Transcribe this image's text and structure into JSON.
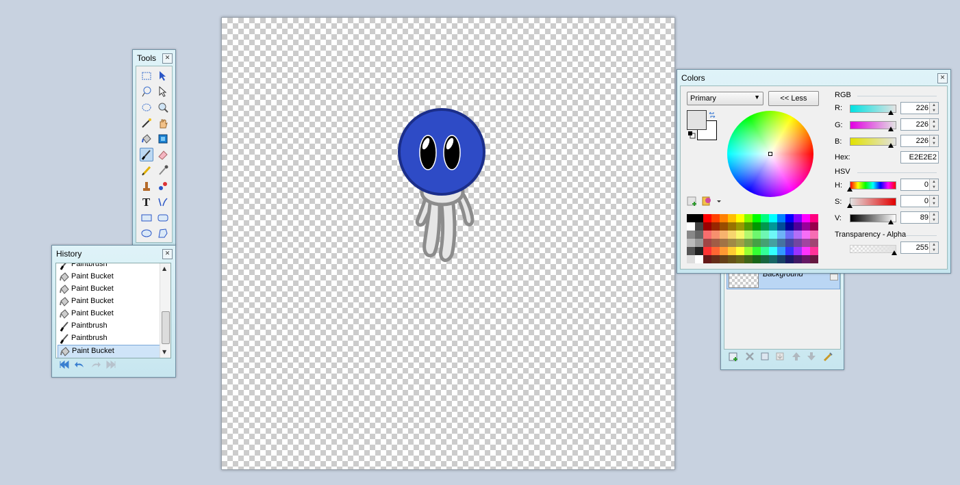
{
  "tools_window": {
    "title": "Tools",
    "close_label": "✕"
  },
  "history_window": {
    "title": "History",
    "close_label": "✕",
    "items": [
      {
        "label": "Paintbrush",
        "icon": "paintbrush-icon"
      },
      {
        "label": "Paint Bucket",
        "icon": "paint-bucket-icon"
      },
      {
        "label": "Paint Bucket",
        "icon": "paint-bucket-icon"
      },
      {
        "label": "Paint Bucket",
        "icon": "paint-bucket-icon"
      },
      {
        "label": "Paint Bucket",
        "icon": "paint-bucket-icon"
      },
      {
        "label": "Paintbrush",
        "icon": "paintbrush-icon"
      },
      {
        "label": "Paintbrush",
        "icon": "paintbrush-icon"
      },
      {
        "label": "Paint Bucket",
        "icon": "paint-bucket-icon"
      }
    ],
    "selected_index": 7
  },
  "colors_window": {
    "title": "Colors",
    "close_label": "✕",
    "mode_select": "Primary",
    "less_button": "<< Less",
    "rgb_heading": "RGB",
    "r_label": "R:",
    "r_value": "226",
    "g_label": "G:",
    "g_value": "226",
    "b_label": "B:",
    "b_value": "226",
    "hex_label": "Hex:",
    "hex_value": "E2E2E2",
    "hsv_heading": "HSV",
    "h_label": "H:",
    "h_value": "0",
    "s_label": "S:",
    "s_value": "0",
    "v_label": "V:",
    "v_value": "89",
    "alpha_heading": "Transparency - Alpha",
    "alpha_value": "255",
    "primary_color": "#e2e2e2",
    "secondary_color": "#ffffff"
  },
  "layers_window": {
    "layer_name": "Background"
  },
  "colors": {
    "blob_blue": "#2e4bc6",
    "blob_outline": "#1b2e8a",
    "body_gray": "#e6e6e6",
    "body_outline": "#8c8c8c"
  }
}
